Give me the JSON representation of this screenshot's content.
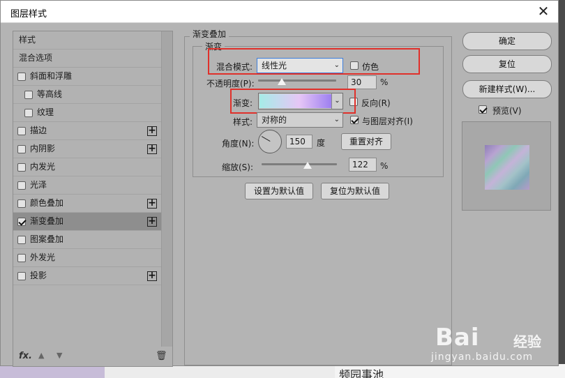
{
  "window": {
    "title": "图层样式",
    "close_glyph": "✕"
  },
  "style_list": {
    "header": "样式",
    "blend_options": "混合选项",
    "items": [
      {
        "label": "斜面和浮雕",
        "checked": false,
        "plus": false,
        "indent": false
      },
      {
        "label": "等高线",
        "checked": false,
        "plus": false,
        "indent": true
      },
      {
        "label": "纹理",
        "checked": false,
        "plus": false,
        "indent": true
      },
      {
        "label": "描边",
        "checked": false,
        "plus": true,
        "indent": false
      },
      {
        "label": "内阴影",
        "checked": false,
        "plus": true,
        "indent": false
      },
      {
        "label": "内发光",
        "checked": false,
        "plus": false,
        "indent": false
      },
      {
        "label": "光泽",
        "checked": false,
        "plus": false,
        "indent": false
      },
      {
        "label": "颜色叠加",
        "checked": false,
        "plus": true,
        "indent": false
      },
      {
        "label": "渐变叠加",
        "checked": true,
        "plus": true,
        "indent": false,
        "selected": true
      },
      {
        "label": "图案叠加",
        "checked": false,
        "plus": false,
        "indent": false
      },
      {
        "label": "外发光",
        "checked": false,
        "plus": false,
        "indent": false
      },
      {
        "label": "投影",
        "checked": false,
        "plus": true,
        "indent": false
      }
    ],
    "plus_glyph": "+",
    "footer": {
      "fx": "fx.",
      "up": "▲",
      "down": "▼",
      "trash": "🗑"
    }
  },
  "gradient_overlay": {
    "group_title": "渐变叠加",
    "subgroup_title": "渐变",
    "blend_mode_label": "混合模式:",
    "blend_mode_value": "线性光",
    "dither_label": "仿色",
    "opacity_label": "不透明度(P):",
    "opacity_value": "30",
    "opacity_fraction": 0.3,
    "percent": "%",
    "gradient_label": "渐变:",
    "reverse_label": "反向(R)",
    "style_label": "样式:",
    "style_value": "对称的",
    "align_label": "与图层对齐(I)",
    "angle_label": "角度(N):",
    "angle_value": "150",
    "degree_unit": "度",
    "reset_align": "重置对齐",
    "scale_label": "缩放(S):",
    "scale_value": "122",
    "scale_fraction": 0.61,
    "set_default": "设置为默认值",
    "reset_default": "复位为默认值",
    "chevron": "⌄"
  },
  "actions": {
    "ok": "确定",
    "reset": "复位",
    "new_style": "新建样式(W)...",
    "preview_label": "预览(V)"
  },
  "background": {
    "peek_text": "频园事池"
  },
  "watermark": {
    "brand": "Bai",
    "jingyan": "经验",
    "url": "jingyan.baidu.com"
  }
}
